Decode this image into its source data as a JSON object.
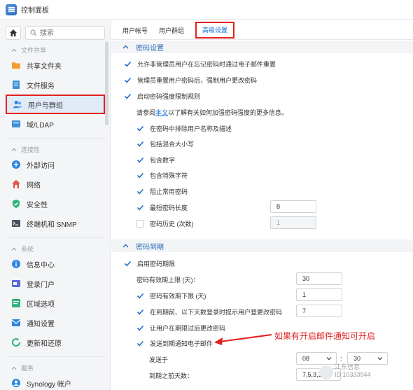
{
  "window": {
    "title": "控制面板"
  },
  "sidebar": {
    "search_placeholder": "搜索",
    "sections": [
      {
        "title": "文件共享"
      },
      {
        "title": "连接性"
      },
      {
        "title": "系统"
      },
      {
        "title": "服务"
      }
    ],
    "items": [
      {
        "label": "共享文件夹",
        "icon": "folder-icon"
      },
      {
        "label": "文件服务",
        "icon": "file-services-icon"
      },
      {
        "label": "用户与群组",
        "icon": "users-icon",
        "active": true
      },
      {
        "label": "域/LDAP",
        "icon": "domain-icon"
      },
      {
        "label": "外部访问",
        "icon": "external-access-icon"
      },
      {
        "label": "网络",
        "icon": "network-icon"
      },
      {
        "label": "安全性",
        "icon": "security-icon"
      },
      {
        "label": "终端机和 SNMP",
        "icon": "terminal-icon"
      },
      {
        "label": "信息中心",
        "icon": "info-icon"
      },
      {
        "label": "登录门户",
        "icon": "login-portal-icon"
      },
      {
        "label": "区域选项",
        "icon": "regional-icon"
      },
      {
        "label": "通知设置",
        "icon": "notification-icon"
      },
      {
        "label": "更新和还原",
        "icon": "update-icon"
      },
      {
        "label": "Synology 帐户",
        "icon": "synology-account-icon"
      }
    ]
  },
  "tabs": [
    {
      "label": "用户帐号"
    },
    {
      "label": "用户群组"
    },
    {
      "label": "高级设置",
      "active": true
    }
  ],
  "password_settings": {
    "title": "密码设置",
    "allow_reset": "允许非管理员用户在忘记密码时通过电子邮件重置",
    "admin_force_change": "管理员重置用户密码后，强制用户更改密码",
    "enable_rules": "启动密码强度限制规则",
    "help_prefix": "请参阅",
    "help_link": "本文",
    "help_suffix": "以了解有关如何加强密码强度的更多信息。",
    "rule_exclude": "在密码中排除用户名称及描述",
    "rule_mixed_case": "包括混合大小写",
    "rule_digits": "包含数字",
    "rule_special": "包含特殊字符",
    "rule_common": "阻止常用密码",
    "rule_min_length": "最短密码长度",
    "min_length_value": "8",
    "rule_history": "密码历史 (次数)",
    "history_value": "1"
  },
  "password_expiry": {
    "title": "密码到期",
    "enable": "启用密码期限",
    "max_age_label": "密码有效期上限 (天)：",
    "max_age_value": "30",
    "min_age_label": "密码有效期下限 (天)",
    "min_age_value": "1",
    "remind_label": "在到期前、以下天数登录时提示用户登更改密码",
    "remind_value": "7",
    "allow_change_expired": "让用户在期限过后更改密码",
    "send_email": "发送到期通知电子邮件",
    "send_at_label": "发送于",
    "hour_value": "08",
    "colon": ":",
    "minute_value": "30",
    "days_before_label": "到期之前天数：",
    "days_before_value": "7,5,3,1"
  },
  "annotation": "如果有开启邮件通知可开启",
  "watermark": {
    "line1": "江东信息",
    "line2": "ID:10333944"
  },
  "colors": {
    "accent": "#0a6fd6",
    "highlight": "#e02020",
    "check": "#1f6fc9"
  }
}
